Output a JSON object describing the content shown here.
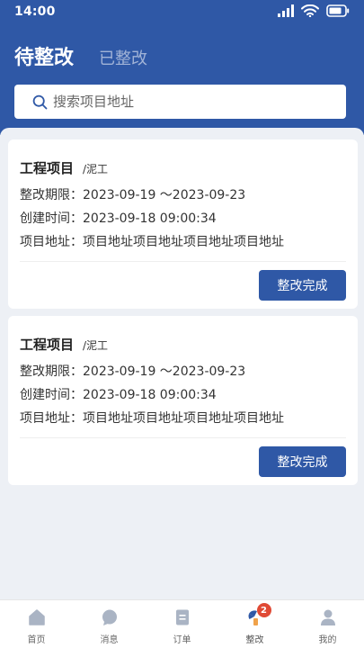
{
  "status_bar": {
    "time": "14:00"
  },
  "header": {
    "tabs": [
      {
        "label": "待整改",
        "active": true
      },
      {
        "label": "已整改",
        "active": false
      }
    ]
  },
  "search": {
    "placeholder": "搜索项目地址",
    "value": ""
  },
  "cards": [
    {
      "title": "工程项目",
      "type": "/泥工",
      "period_label": "整改期限：",
      "period_value": "2023-09-19 ～2023-09-23",
      "created_label": "创建时间：",
      "created_value": "2023-09-18  09:00:34",
      "address_label": "项目地址：",
      "address_value": "项目地址项目地址项目地址项目地址",
      "button_label": "整改完成"
    },
    {
      "title": "工程项目",
      "type": "/泥工",
      "period_label": "整改期限：",
      "period_value": "2023-09-19 ～2023-09-23",
      "created_label": "创建时间：",
      "created_value": "2023-09-18  09:00:34",
      "address_label": "项目地址：",
      "address_value": "项目地址项目地址项目地址项目地址",
      "button_label": "整改完成"
    }
  ],
  "bottom_nav": [
    {
      "label": "首页",
      "icon": "home-icon"
    },
    {
      "label": "消息",
      "icon": "message-icon"
    },
    {
      "label": "订单",
      "icon": "order-icon"
    },
    {
      "label": "整改",
      "icon": "rectify-icon",
      "badge": "2",
      "active": true
    },
    {
      "label": "我的",
      "icon": "profile-icon"
    }
  ],
  "colors": {
    "primary": "#2f58a6",
    "background": "#edf0f5",
    "badge": "#e04a35",
    "nav_icon": "#aab4c4"
  }
}
